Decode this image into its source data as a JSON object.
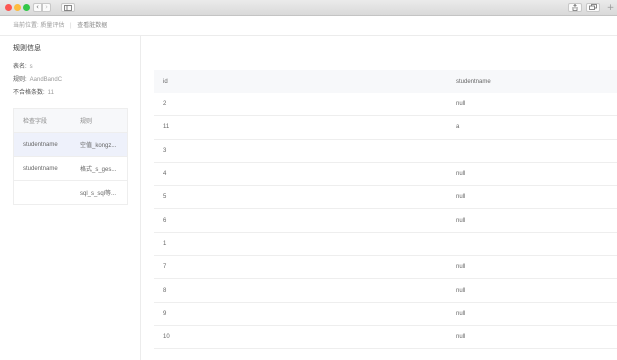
{
  "breadcrumb": {
    "prefix": "当前位置:",
    "current": "质量评估",
    "separator": "|",
    "link": "查看脏数据"
  },
  "rule_info": {
    "title": "规则信息",
    "table_name_label": "表名:",
    "table_name_value": "s",
    "rule_label": "规则:",
    "rule_value": "AandBandC",
    "failed_count_label": "不合格条数:",
    "failed_count_value": "11"
  },
  "rule_table": {
    "headers": [
      "检查字段",
      "规则"
    ],
    "rows": [
      [
        "studentname",
        "空值_kongz..."
      ],
      [
        "studentname",
        "格式_s_ges..."
      ],
      [
        "",
        "sql_s_sql等..."
      ]
    ]
  },
  "data_table": {
    "headers": [
      "id",
      "studentname"
    ],
    "rows": [
      [
        "2",
        "null"
      ],
      [
        "11",
        "a"
      ],
      [
        "3",
        ""
      ],
      [
        "4",
        "null"
      ],
      [
        "5",
        "null"
      ],
      [
        "6",
        "null"
      ],
      [
        "1",
        ""
      ],
      [
        "7",
        "null"
      ],
      [
        "8",
        "null"
      ],
      [
        "9",
        "null"
      ],
      [
        "10",
        "null"
      ]
    ]
  },
  "window": {
    "back_icon": "chevron-left-icon",
    "forward_icon": "chevron-right-icon",
    "sidebar_icon": "sidebar-icon",
    "share_icon": "share-icon",
    "tabs_icon": "tabs-icon",
    "plus_icon": "plus-icon"
  }
}
